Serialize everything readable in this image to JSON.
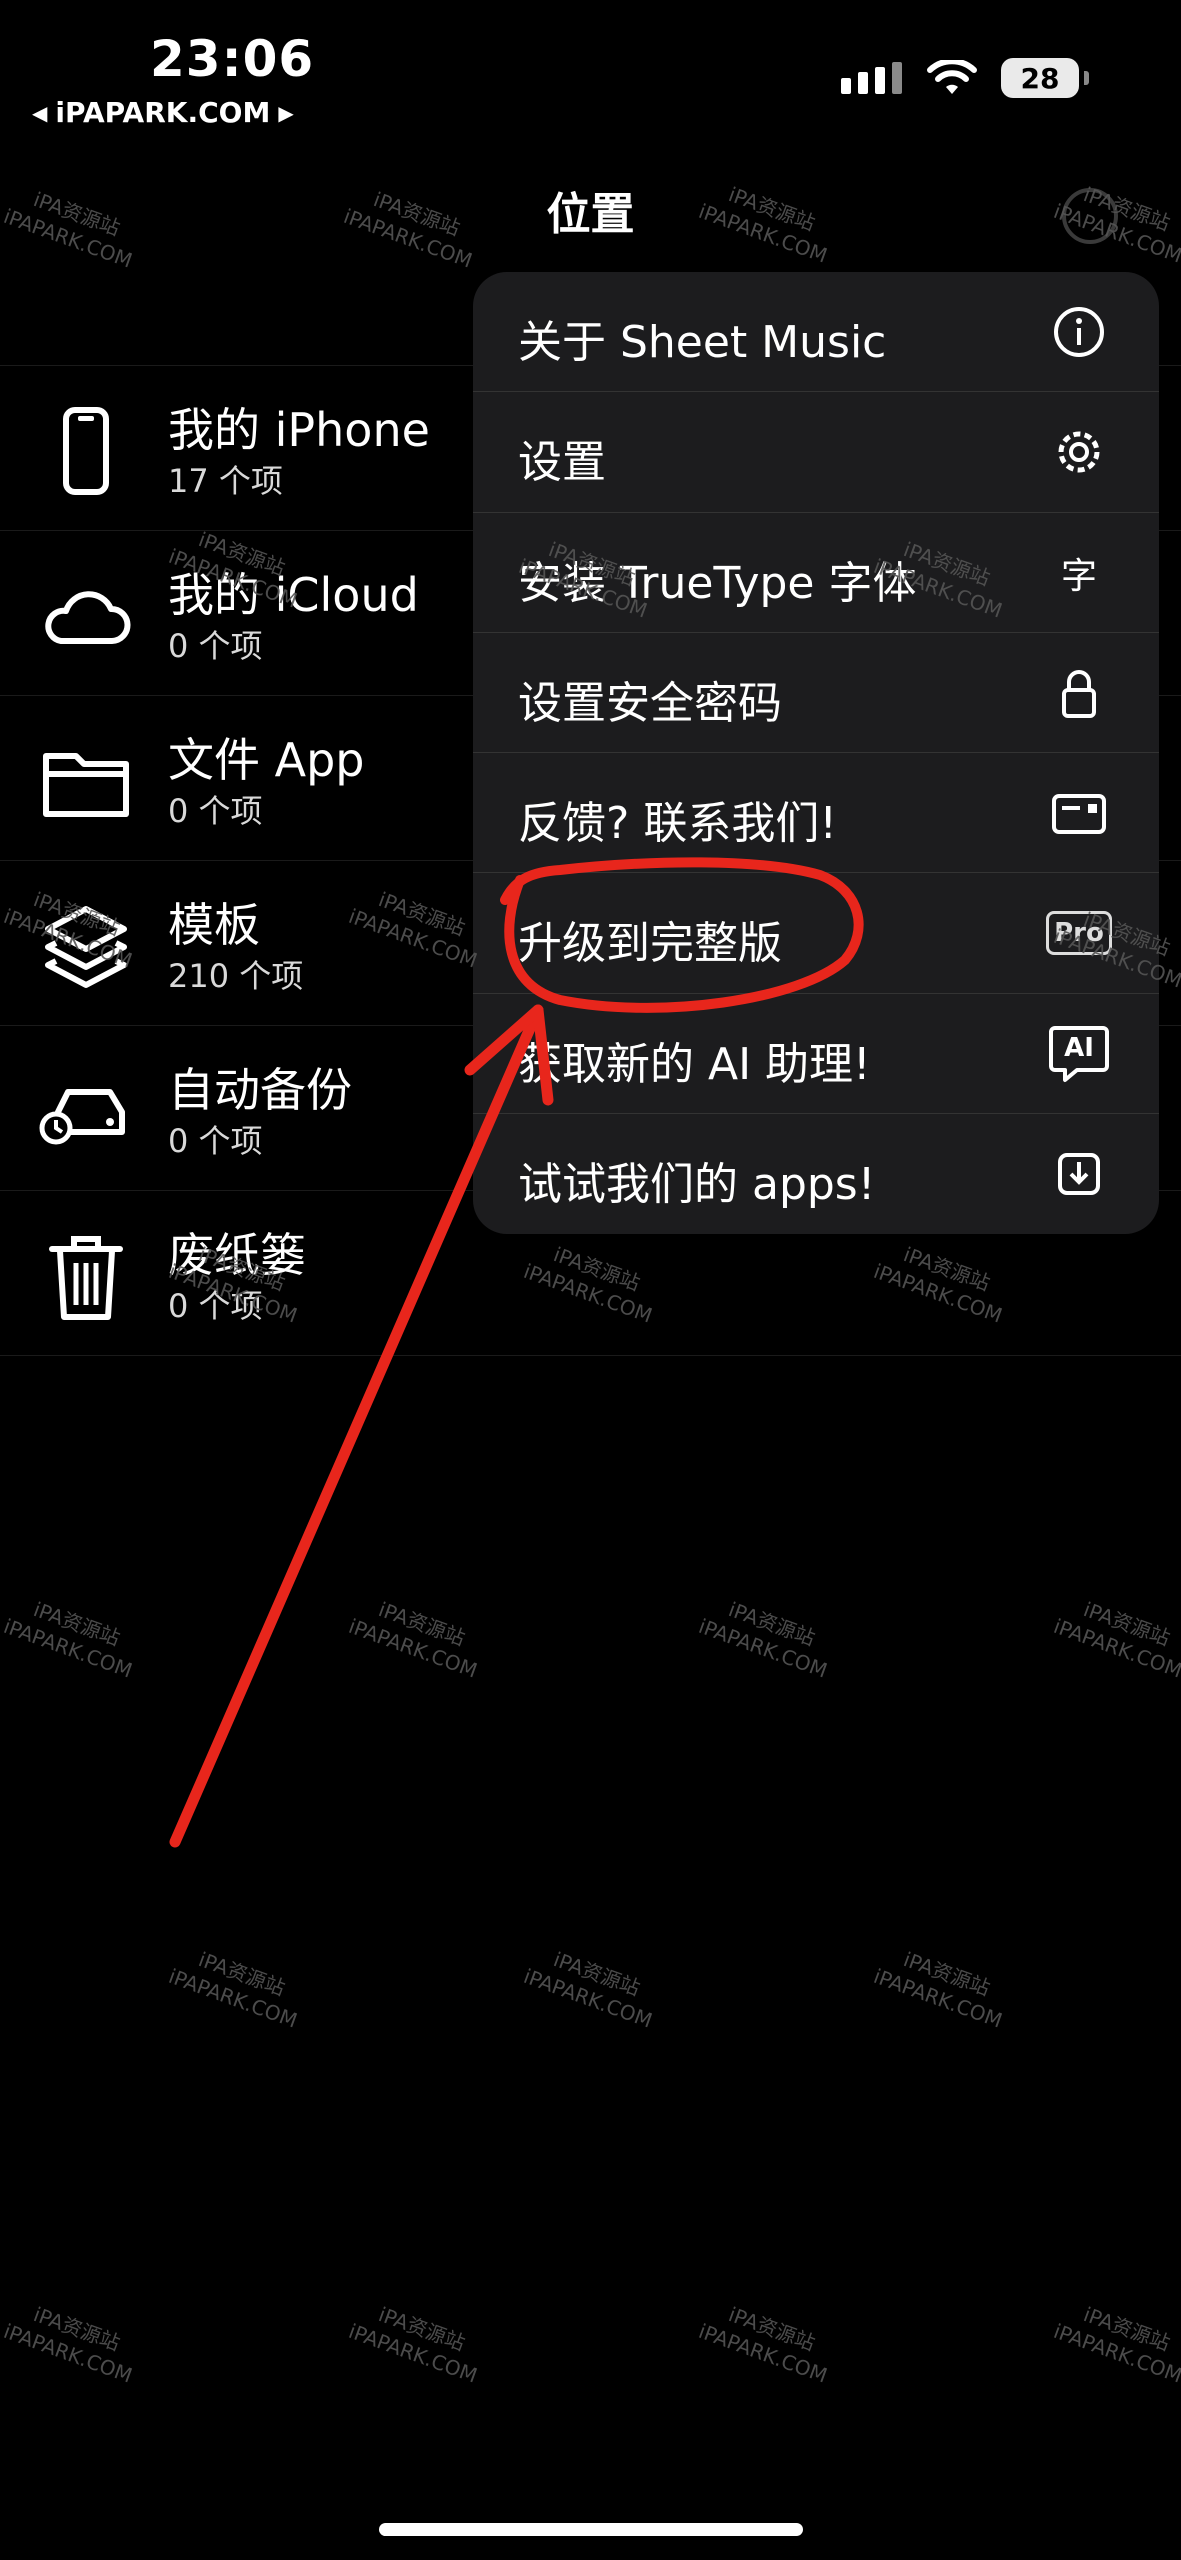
{
  "status_bar": {
    "time": "23:06",
    "back_label": "iPAPARK.COM",
    "battery": "28",
    "icons": [
      "signal-icon",
      "wifi-icon",
      "battery-icon"
    ]
  },
  "nav": {
    "title": "位置",
    "more_icon": "ellipsis-circle-icon"
  },
  "locations": [
    {
      "name": "我的 iPhone",
      "count": "17 个项",
      "icon": "iphone-icon"
    },
    {
      "name": "我的 iCloud",
      "count": "0 个项",
      "icon": "cloud-icon"
    },
    {
      "name": "文件 App",
      "count": "0 个项",
      "icon": "folder-icon"
    },
    {
      "name": "模板",
      "count": "210 个项",
      "icon": "layers-icon"
    },
    {
      "name": "自动备份",
      "count": "0 个项",
      "icon": "backup-drive-icon"
    },
    {
      "name": "废纸篓",
      "count": "0 个项",
      "icon": "trash-icon"
    }
  ],
  "menu": {
    "items": [
      {
        "label": "关于 Sheet Music",
        "icon": "info-icon"
      },
      {
        "label": "设置",
        "icon": "gear-icon"
      },
      {
        "label": "安装 TrueType 字体",
        "icon": "font-char-icon",
        "icon_text": "字"
      },
      {
        "label": "设置安全密码",
        "icon": "lock-icon"
      },
      {
        "label": "反馈? 联系我们!",
        "icon": "card-icon"
      },
      {
        "label": "升级到完整版",
        "icon": "pro-badge-icon",
        "icon_text": "Pro"
      },
      {
        "label": "获取新的 AI 助理!",
        "icon": "ai-bubble-icon",
        "icon_text": "AI"
      },
      {
        "label": "试试我们的 apps!",
        "icon": "download-icon"
      }
    ]
  },
  "watermark": {
    "line1": "iPA资源站",
    "line2": "iPAPARK.COM"
  },
  "colors": {
    "background": "#000000",
    "menu_bg": "#1c1c1e",
    "annotation": "#e8261c"
  }
}
